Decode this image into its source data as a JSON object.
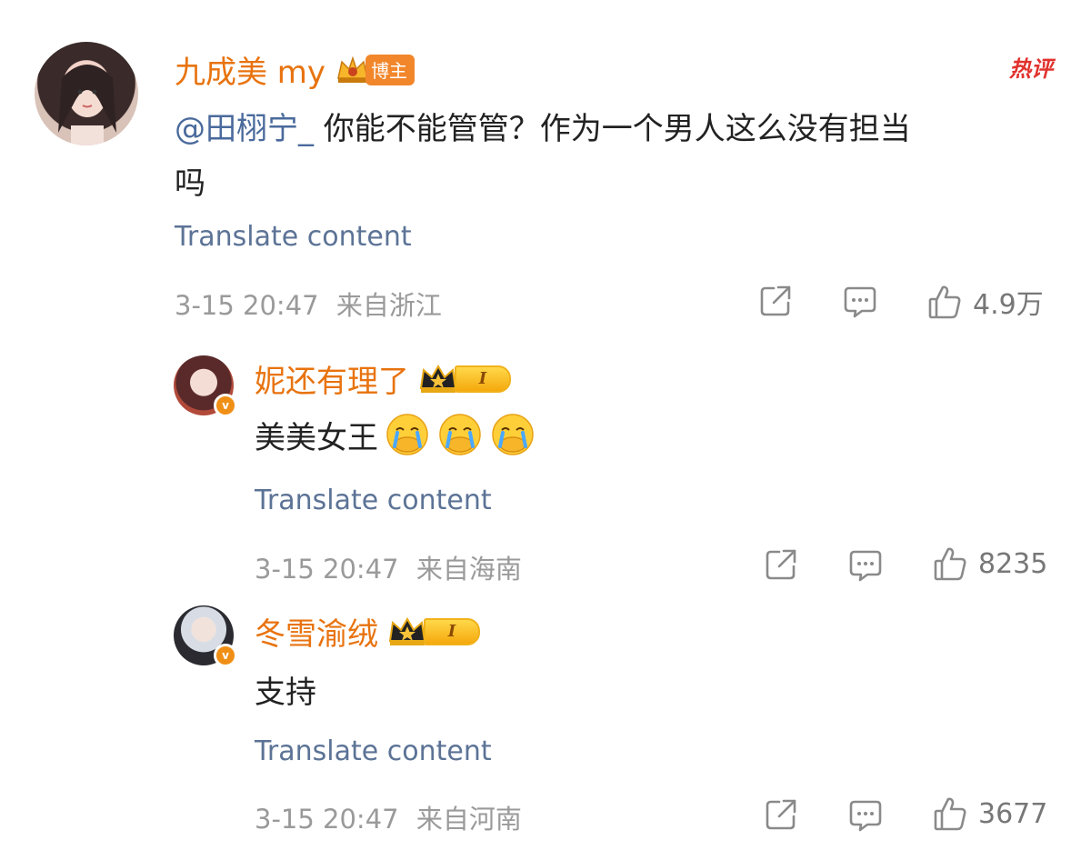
{
  "comments": [
    {
      "username": "九成美 my",
      "badge_label": "博主",
      "hot_label": "热评",
      "mention": "@田栩宁_",
      "text_line1": " 你能不能管管？作为一个男人这么没有担当",
      "text_line2": "吗",
      "translate": "Translate content",
      "time": "3-15 20:47",
      "location": "来自浙江",
      "likes": "4.9万"
    }
  ],
  "replies": [
    {
      "username": "妮还有理了",
      "level": "I",
      "text": "美美女王",
      "emoji_icon": "crying-face-icon",
      "translate": "Translate content",
      "time": "3-15 20:47",
      "location": "来自海南",
      "likes": "8235"
    },
    {
      "username": "冬雪渝绒",
      "level": "I",
      "text": "支持",
      "translate": "Translate content",
      "time": "3-15 20:47",
      "location": "来自河南",
      "likes": "3677"
    }
  ],
  "colors": {
    "name": "#e8730f",
    "link": "#5c7396",
    "meta": "#9a9a9a",
    "hot": "#e1322d"
  }
}
